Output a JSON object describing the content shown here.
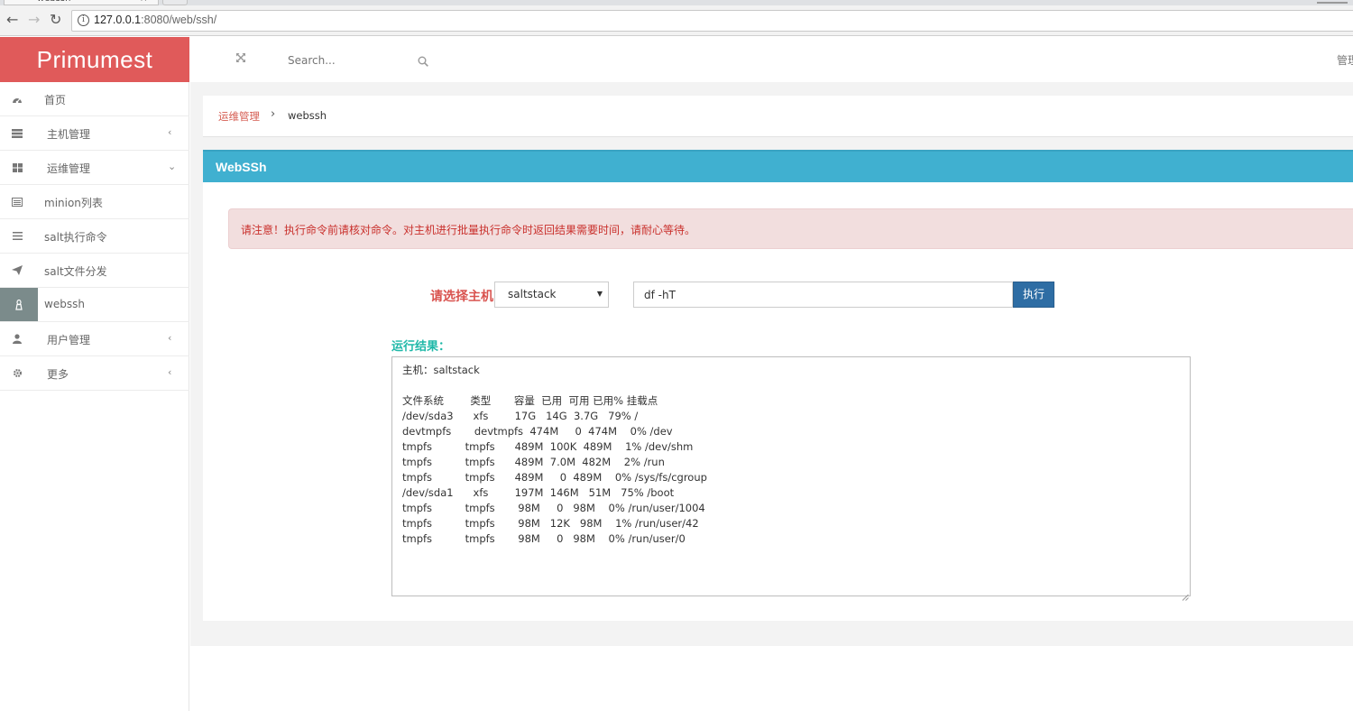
{
  "browser": {
    "tab_title": "webssh",
    "tab_close": "×",
    "url_host": "127.0.0.1",
    "url_rest": ":8080/web/ssh/"
  },
  "sidebar": {
    "logo": "Primumest",
    "items": [
      {
        "label": "首页",
        "icon": "dashboard-icon",
        "arrow": ""
      },
      {
        "label": "主机管理",
        "icon": "server-icon",
        "arrow": "‹"
      },
      {
        "label": "运维管理",
        "icon": "grid-icon",
        "arrow": "⌄"
      },
      {
        "label": "minion列表",
        "icon": "list-alt-icon",
        "arrow": ""
      },
      {
        "label": "salt执行命令",
        "icon": "menu-icon",
        "arrow": ""
      },
      {
        "label": "salt文件分发",
        "icon": "send-icon",
        "arrow": ""
      },
      {
        "label": "webssh",
        "icon": "linux-icon",
        "arrow": ""
      },
      {
        "label": "用户管理",
        "icon": "user-icon",
        "arrow": "‹"
      },
      {
        "label": "更多",
        "icon": "gear-icon",
        "arrow": "‹"
      }
    ]
  },
  "topbar": {
    "search_placeholder": "Search...",
    "admin_label": "管理"
  },
  "breadcrumb": {
    "parent": "运维管理",
    "separator": "›",
    "current": "webssh"
  },
  "panel": {
    "title": "WebSSh",
    "alert": "请注意！执行命令前请核对命令。对主机进行批量执行命令时返回结果需要时间，请耐心等待。",
    "host_label": "请选择主机",
    "host_selected": "saltstack",
    "command_value": "df -hT",
    "exec_label": "执行",
    "result_label": "运行结果：",
    "result_text": "主机：saltstack\n\n文件系统        类型       容量  已用  可用 已用% 挂载点\n/dev/sda3      xfs        17G   14G  3.7G   79% /\ndevtmpfs       devtmpfs  474M     0  474M    0% /dev\ntmpfs          tmpfs      489M  100K  489M    1% /dev/shm\ntmpfs          tmpfs      489M  7.0M  482M    2% /run\ntmpfs          tmpfs      489M     0  489M    0% /sys/fs/cgroup\n/dev/sda1      xfs        197M  146M   51M   75% /boot\ntmpfs          tmpfs       98M     0   98M    0% /run/user/1004\ntmpfs          tmpfs       98M   12K   98M    1% /run/user/42\ntmpfs          tmpfs       98M     0   98M    0% /run/user/0"
  },
  "colors": {
    "logo_bg": "#e05a5a",
    "panel_header": "#40b0d0",
    "alert_bg": "#f2dede",
    "alert_text": "#c9302c",
    "exec_button": "#2e6da4",
    "result_label": "#1fb8a8"
  }
}
